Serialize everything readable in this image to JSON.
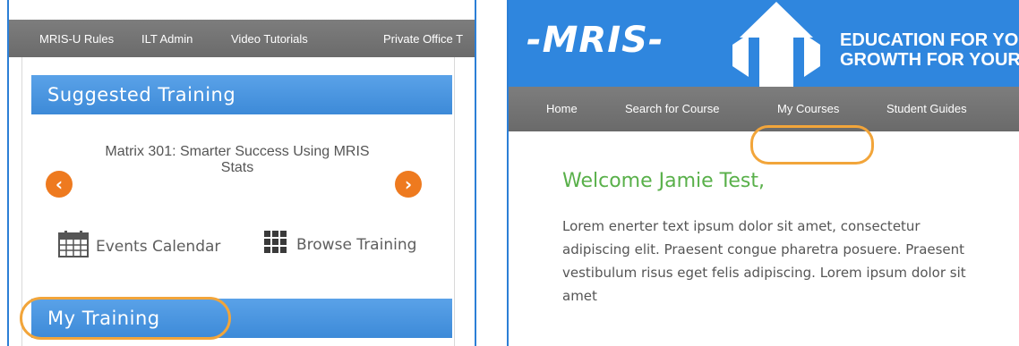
{
  "left_panel": {
    "nav": [
      "MRIS-U Rules",
      "ILT Admin",
      "Video Tutorials",
      "Private Office T"
    ],
    "suggested_title": "Suggested Training",
    "course_title": "Matrix 301: Smarter Success Using MRIS Stats",
    "prev_symbol": "‹",
    "next_symbol": "›",
    "events_label": "Events Calendar",
    "browse_label": "Browse Training",
    "my_training_title": "My Training"
  },
  "right_panel": {
    "logo": "-MRIS-",
    "tagline_line1": "EDUCATION FOR YOU",
    "tagline_line2": "GROWTH FOR YOUR",
    "nav": [
      "Home",
      "Search for Course",
      "My Courses",
      "Student Guides"
    ],
    "welcome": "Welcome Jamie Test,",
    "body": "Lorem enerter text  ipsum dolor sit amet, consectetur adipiscing elit. Praesent congue pharetra posuere. Praesent vestibulum risus eget felis adipiscing. Lorem ipsum dolor sit amet"
  },
  "colors": {
    "accent_blue": "#2f86de",
    "section_blue": "#4a94e0",
    "nav_gray": "#747474",
    "orange": "#ee7a1f",
    "highlight_orange": "#f2a53a",
    "welcome_green": "#59b04a"
  },
  "icons": {
    "prev": "chevron-left-icon",
    "next": "chevron-right-icon",
    "calendar": "calendar-icon",
    "grid": "grid-icon"
  }
}
